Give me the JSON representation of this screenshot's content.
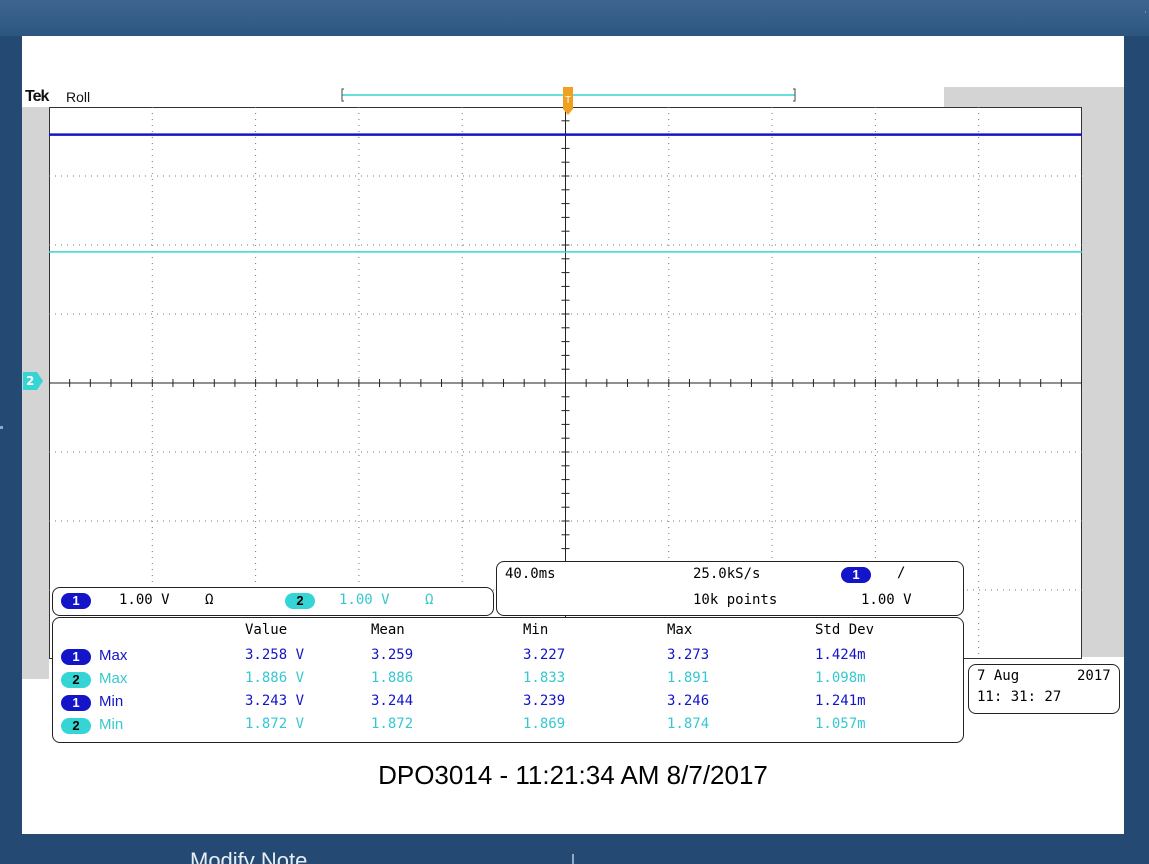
{
  "scope": {
    "brand": "Tek",
    "mode": "Roll",
    "trigger_marker": "T",
    "ch2_ground_marker": "2"
  },
  "channels": [
    {
      "id": "1",
      "scale": "1.00 V",
      "coupling": "Ω",
      "color": "#1414c8"
    },
    {
      "id": "2",
      "scale": "1.00 V",
      "coupling": "Ω",
      "color": "#36d5d5"
    }
  ],
  "timebase": {
    "horizontal_scale": "40.0ms",
    "sample_rate": "25.0kS/s",
    "record_length": "10k points",
    "trigger_source": "1",
    "trigger_slope": "/",
    "trigger_level": "1.00 V"
  },
  "measurements": {
    "columns": [
      "Value",
      "Mean",
      "Min",
      "Max",
      "Std Dev"
    ],
    "rows": [
      {
        "channel": "1",
        "name": "Max",
        "value": "3.258 V",
        "mean": "3.259",
        "min": "3.227",
        "max": "3.273",
        "std_dev": "1.424m"
      },
      {
        "channel": "2",
        "name": "Max",
        "value": "1.886 V",
        "mean": "1.886",
        "min": "1.833",
        "max": "1.891",
        "std_dev": "1.098m"
      },
      {
        "channel": "1",
        "name": "Min",
        "value": "3.243 V",
        "mean": "3.244",
        "min": "3.239",
        "max": "3.246",
        "std_dev": "1.241m"
      },
      {
        "channel": "2",
        "name": "Min",
        "value": "1.872 V",
        "mean": "1.872",
        "min": "1.869",
        "max": "1.874",
        "std_dev": "1.057m"
      }
    ]
  },
  "datetime": {
    "date_day_month": "7 Aug",
    "year": "2017",
    "time": "11: 31: 27"
  },
  "page_caption": "DPO3014 - 11:21:34 AM   8/7/2017",
  "bottom_note": "Modify Note",
  "colors": {
    "ch1": "#1414c8",
    "ch2": "#36d5d5",
    "window_bg": "#244a74"
  },
  "traces": [
    {
      "channel": "1",
      "level_divisions": 3.6
    },
    {
      "channel": "2",
      "level_divisions": 1.9
    }
  ]
}
